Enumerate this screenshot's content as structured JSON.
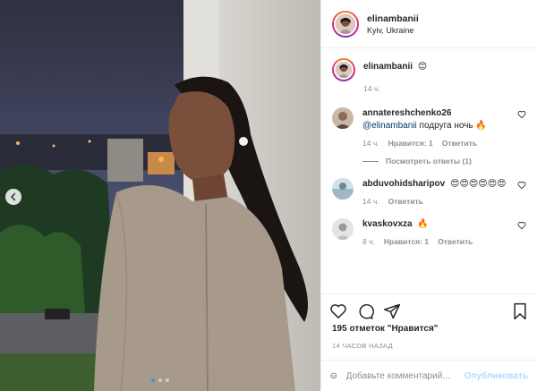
{
  "post": {
    "author": {
      "username": "elinambanii",
      "location": "Kyiv, Ukraine"
    },
    "media": {
      "slide_count": 3,
      "active_slide": 1
    },
    "caption": {
      "username": "elinambanii",
      "emoji": "😊",
      "time": "14 ч."
    },
    "comments": [
      {
        "username": "annatereshchenko26",
        "mention": "@elinambanii",
        "text": " подруга ночь 🔥",
        "time": "14 ч.",
        "likes": "Нравится: 1",
        "reply": "Ответить",
        "view_replies": "Посмотреть ответы (1)"
      },
      {
        "username": "abduvohidsharipov",
        "text": "😍😍😍😍😍😍",
        "time": "14 ч.",
        "reply": "Ответить"
      },
      {
        "username": "kvaskovxza",
        "text": "🔥",
        "time": "8 ч.",
        "likes": "Нравится: 1",
        "reply": "Ответить"
      }
    ],
    "likes_text": "195 отметок \"Нравится\"",
    "time_ago": "14 ЧАСОВ НАЗАД",
    "add_comment": {
      "placeholder": "Добавьте комментарий...",
      "publish_label": "Опубликовать"
    }
  },
  "icons": {
    "prev": "chevron-left-icon",
    "like": "heart-icon",
    "comment": "comment-icon",
    "share": "share-icon",
    "save": "bookmark-icon",
    "emoji": "emoji-icon"
  },
  "colors": {
    "accent": "#3897f0",
    "publish_disabled": "#b3dbff",
    "mention": "#00376b",
    "muted": "#8e8e8e"
  }
}
